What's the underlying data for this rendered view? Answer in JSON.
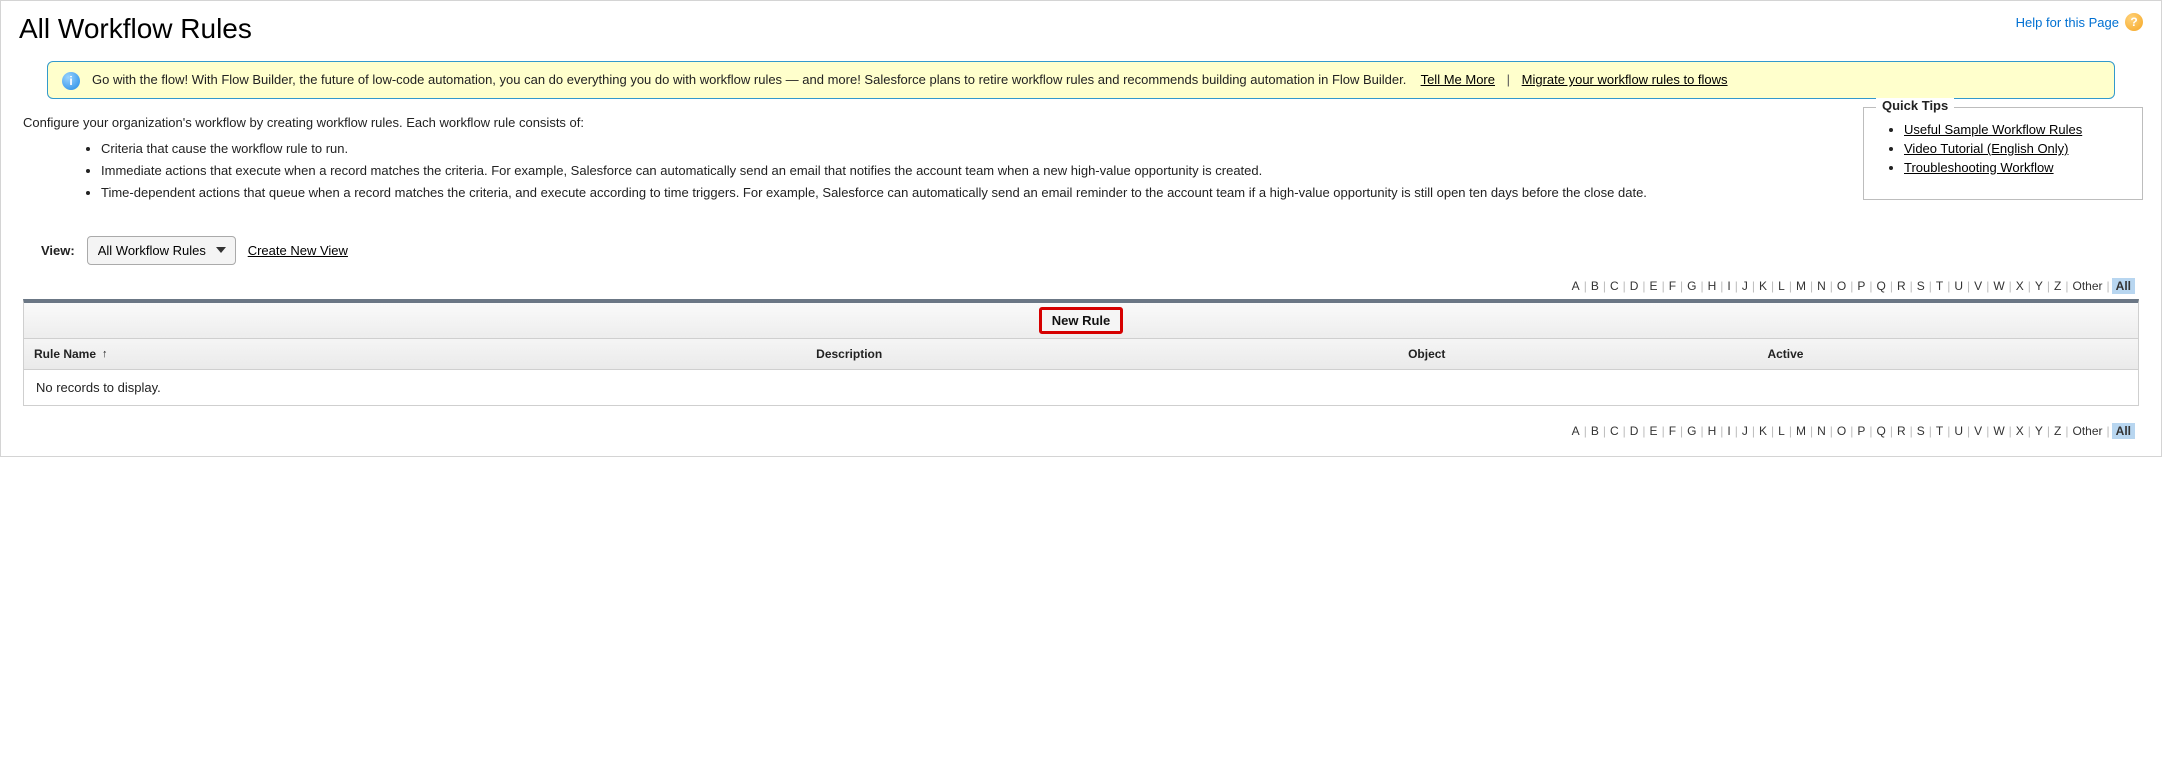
{
  "header": {
    "title": "All Workflow Rules",
    "help_label": "Help for this Page"
  },
  "banner": {
    "text": "Go with the flow! With Flow Builder, the future of low-code automation, you can do everything you do with workflow rules — and more! Salesforce plans to retire workflow rules and recommends building automation in Flow Builder.",
    "tell_me_more": "Tell Me More",
    "separator": "|",
    "migrate_link": "Migrate your workflow rules to flows"
  },
  "intro": {
    "sentence": "Configure your organization's workflow by creating workflow rules. Each workflow rule consists of:",
    "bullets": [
      "Criteria that cause the workflow rule to run.",
      "Immediate actions that execute when a record matches the criteria. For example, Salesforce can automatically send an email that notifies the account team when a new high-value opportunity is created.",
      "Time-dependent actions that queue when a record matches the criteria, and execute according to time triggers. For example, Salesforce can automatically send an email reminder to the account team if a high-value opportunity is still open ten days before the close date."
    ]
  },
  "quick_tips": {
    "title": "Quick Tips",
    "items": [
      "Useful Sample Workflow Rules",
      "Video Tutorial (English Only)",
      "Troubleshooting Workflow"
    ]
  },
  "view": {
    "label": "View:",
    "selected": "All Workflow Rules",
    "create_new": "Create New View"
  },
  "alpha": {
    "letters": [
      "A",
      "B",
      "C",
      "D",
      "E",
      "F",
      "G",
      "H",
      "I",
      "J",
      "K",
      "L",
      "M",
      "N",
      "O",
      "P",
      "Q",
      "R",
      "S",
      "T",
      "U",
      "V",
      "W",
      "X",
      "Y",
      "Z"
    ],
    "other": "Other",
    "all": "All"
  },
  "table": {
    "new_rule_label": "New Rule",
    "columns": {
      "name": "Rule Name",
      "description": "Description",
      "object": "Object",
      "active": "Active"
    },
    "empty": "No records to display."
  }
}
